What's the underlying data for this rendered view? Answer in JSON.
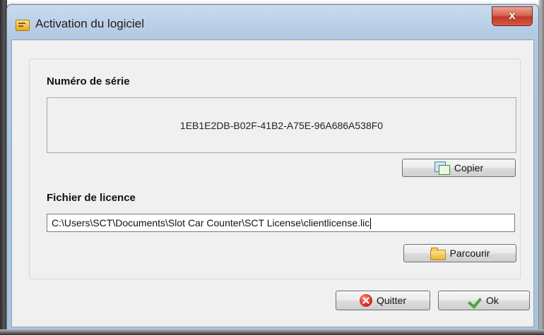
{
  "window": {
    "title": "Activation du logiciel",
    "close_label": "x"
  },
  "serial": {
    "label": "Numéro de série",
    "value": "1EB1E2DB-B02F-41B2-A75E-96A686A538F0",
    "copy_button": "Copier"
  },
  "license": {
    "label": "Fichier de licence",
    "path": "C:\\Users\\SCT\\Documents\\Slot Car Counter\\SCT License\\clientlicense.lic",
    "browse_button": "Parcourir"
  },
  "footer": {
    "quit_button": "Quitter",
    "ok_button": "Ok"
  },
  "icons": {
    "app": "license-app-icon",
    "copy": "copy-icon",
    "browse": "folder-icon",
    "quit": "quit-icon",
    "ok": "checkmark-icon"
  }
}
